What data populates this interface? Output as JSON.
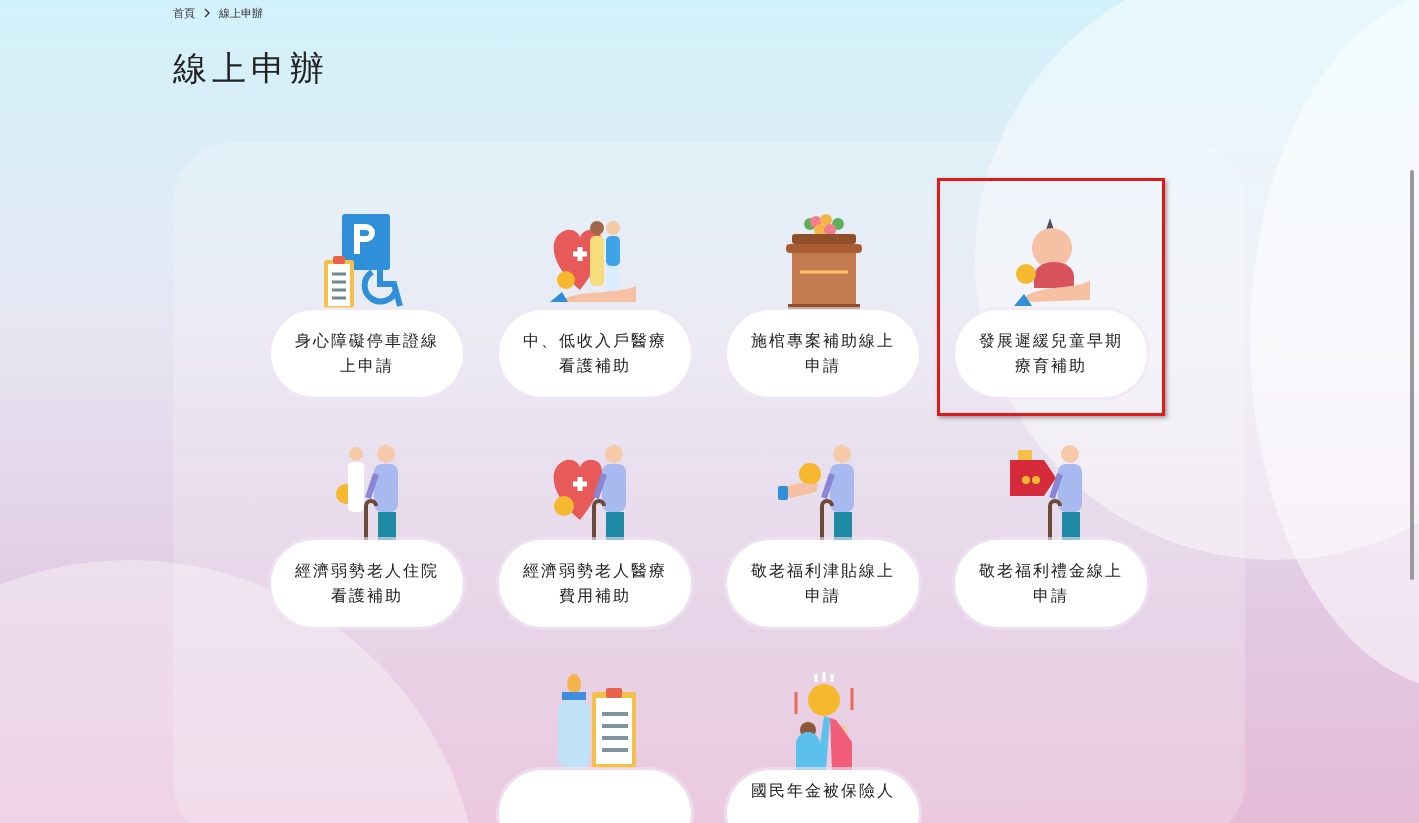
{
  "breadcrumb": [
    {
      "label": "首頁"
    },
    {
      "label": "線上申辦"
    }
  ],
  "title": "線上申辦",
  "services": [
    {
      "kind": "parking",
      "label": [
        "身心障礙停車證線",
        "上申請"
      ],
      "highlighted": false
    },
    {
      "kind": "family-care",
      "label": [
        "中、低收入戶醫療",
        "看護補助"
      ],
      "highlighted": false
    },
    {
      "kind": "coffin",
      "label": [
        "施棺專案補助線上",
        "申請"
      ],
      "highlighted": false
    },
    {
      "kind": "baby",
      "label": [
        "發展遲緩兒童早期",
        "療育補助"
      ],
      "highlighted": true
    },
    {
      "kind": "elder-care",
      "label": [
        "經濟弱勢老人住院",
        "看護補助"
      ],
      "highlighted": false
    },
    {
      "kind": "elder-medical",
      "label": [
        "經濟弱勢老人醫療",
        "費用補助"
      ],
      "highlighted": false
    },
    {
      "kind": "elder-coin",
      "label": [
        "敬老福利津貼線上",
        "申請"
      ],
      "highlighted": false
    },
    {
      "kind": "elder-gift",
      "label": [
        "敬老福利禮金線上",
        "申請"
      ],
      "highlighted": false
    },
    {
      "kind": "bottle",
      "highlighted": false
    },
    {
      "kind": "coin-people",
      "label": [
        "國民年金被保險人"
      ],
      "highlighted": false
    }
  ]
}
